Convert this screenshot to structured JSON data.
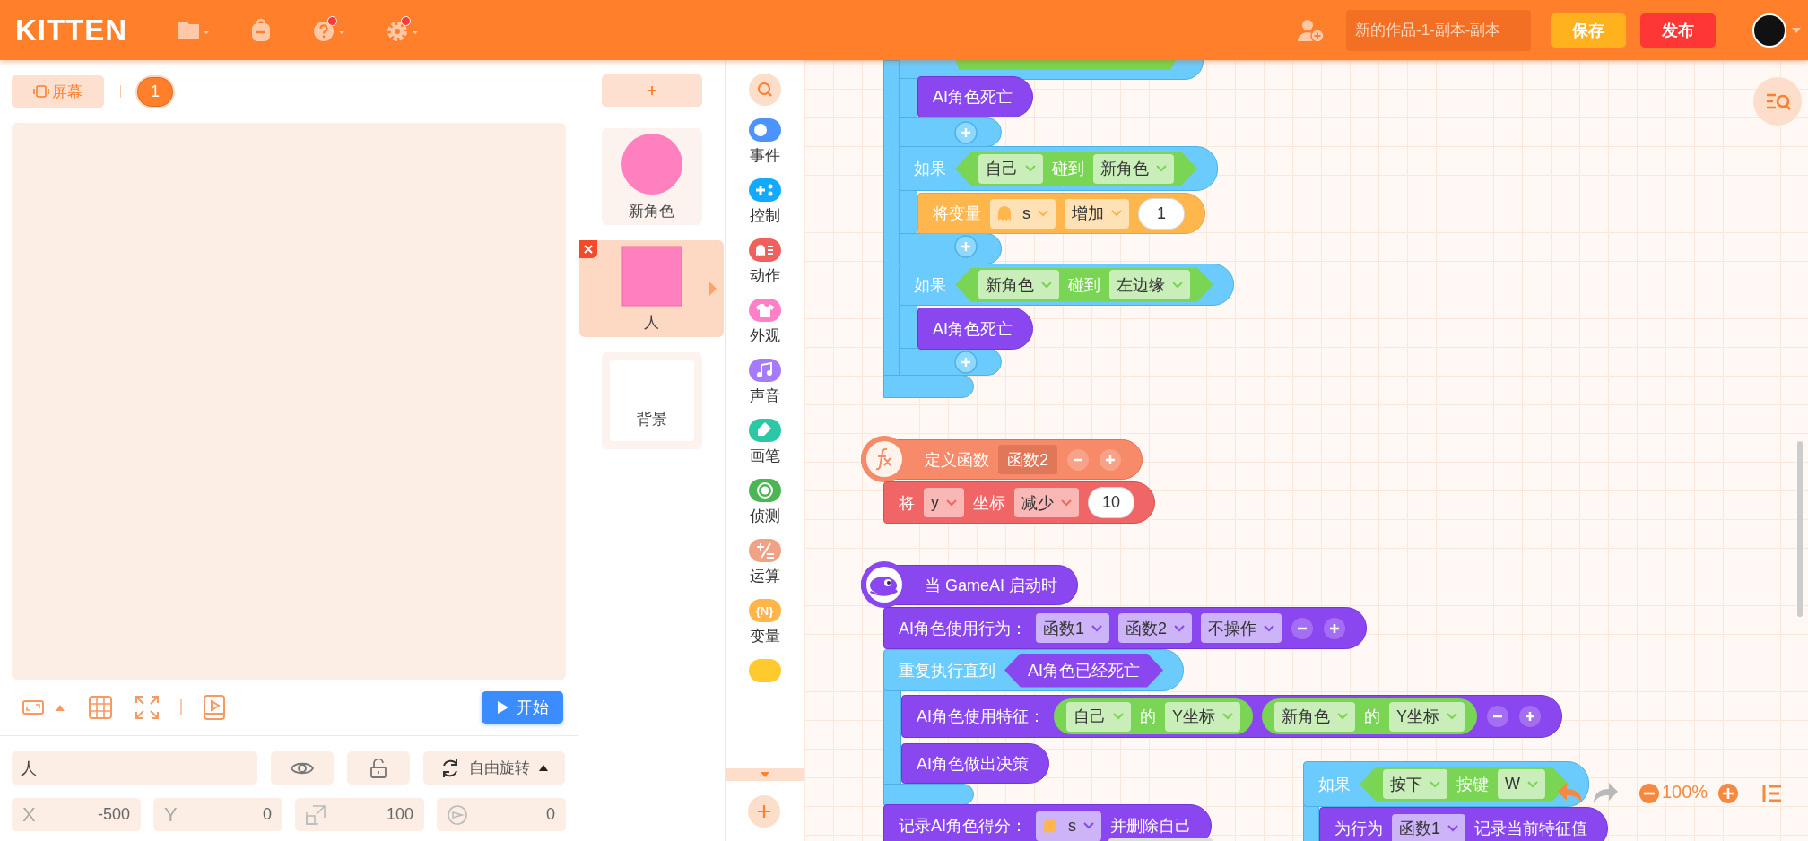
{
  "header": {
    "logo": "KITTEN",
    "toolbar_icons": [
      {
        "kind": "folder",
        "dot": false
      },
      {
        "kind": "bag",
        "dot": false
      },
      {
        "kind": "help",
        "dot": true
      },
      {
        "kind": "settings",
        "dot": true
      }
    ],
    "project_name": "新的作品-1-副本-副本",
    "save_button": "保存",
    "publish_button": "发布"
  },
  "stage_tabs": [
    {
      "label": "屏幕",
      "selected": false
    },
    {
      "label": "1",
      "selected": true
    }
  ],
  "start_button": "开始",
  "sprite_props": {
    "name": "人",
    "rotation": "自由旋转",
    "fields": [
      {
        "kind": "x",
        "label": "X",
        "value": "-500"
      },
      {
        "kind": "y",
        "label": "Y",
        "value": "0"
      },
      {
        "kind": "size",
        "value": "100"
      },
      {
        "kind": "direction",
        "value": "0"
      }
    ]
  },
  "sprites": [
    {
      "name": "新角色",
      "kind": "circle",
      "selected": false
    },
    {
      "name": "人",
      "kind": "square",
      "selected": true
    },
    {
      "name": "背景",
      "kind": "background",
      "selected": false
    }
  ],
  "categories": [
    {
      "kind": "events",
      "label": "事件",
      "color": "#4c93ff"
    },
    {
      "kind": "control",
      "label": "控制",
      "color": "#12aaff"
    },
    {
      "kind": "motion",
      "label": "动作",
      "color": "#f0605c"
    },
    {
      "kind": "looks",
      "label": "外观",
      "color": "#ff80c8"
    },
    {
      "kind": "sound",
      "label": "声音",
      "color": "#a67bfa"
    },
    {
      "kind": "pen",
      "label": "画笔",
      "color": "#2bc8a6"
    },
    {
      "kind": "sensing",
      "label": "侦测",
      "color": "#4cb654"
    },
    {
      "kind": "operators",
      "label": "运算",
      "color": "#f0a284"
    },
    {
      "kind": "variables",
      "label": "变量",
      "color": "#ffb54a",
      "icon_text": "{N}"
    },
    {
      "kind": "list",
      "color": "#ffca2e"
    }
  ],
  "script_blocks": [
    {
      "kind": "ai",
      "parts": [
        {
          "kind": "label",
          "text": "AI角色死亡"
        }
      ]
    },
    {
      "kind": "control",
      "parts": [
        {
          "kind": "label",
          "text": "如果"
        },
        {
          "kind": "condition",
          "color": "#79d553",
          "parts": [
            {
              "kind": "dropdown",
              "text": "自己"
            },
            {
              "kind": "label",
              "text": "碰到"
            },
            {
              "kind": "dropdown",
              "text": "新角色"
            }
          ]
        }
      ]
    },
    {
      "kind": "variable",
      "parts": [
        {
          "kind": "label",
          "text": "将变量"
        },
        {
          "kind": "var-dropdown",
          "text": "s"
        },
        {
          "kind": "dropdown",
          "text": "增加"
        },
        {
          "kind": "number",
          "text": "1"
        }
      ]
    },
    {
      "kind": "control",
      "parts": [
        {
          "kind": "label",
          "text": "如果"
        },
        {
          "kind": "condition",
          "color": "#79d553",
          "parts": [
            {
              "kind": "dropdown",
              "text": "新角色"
            },
            {
              "kind": "label",
              "text": "碰到"
            },
            {
              "kind": "dropdown",
              "text": "左边缘"
            }
          ]
        }
      ]
    },
    {
      "kind": "ai",
      "parts": [
        {
          "kind": "label",
          "text": "AI角色死亡"
        }
      ]
    },
    {
      "kind": "function",
      "parts": [
        {
          "kind": "label",
          "text": "定义函数"
        },
        {
          "kind": "slot",
          "text": "函数2"
        },
        {
          "kind": "minus"
        },
        {
          "kind": "plus"
        }
      ]
    },
    {
      "kind": "motion",
      "parts": [
        {
          "kind": "label",
          "text": "将"
        },
        {
          "kind": "dropdown",
          "text": "y"
        },
        {
          "kind": "label",
          "text": "坐标"
        },
        {
          "kind": "dropdown",
          "text": "减少"
        },
        {
          "kind": "number",
          "text": "10"
        }
      ]
    },
    {
      "kind": "event",
      "parts": [
        {
          "kind": "label",
          "text": "当 GameAI 启动时"
        }
      ]
    },
    {
      "kind": "ai",
      "parts": [
        {
          "kind": "label",
          "text": "AI角色使用行为："
        },
        {
          "kind": "dropdown",
          "text": "函数1"
        },
        {
          "kind": "dropdown",
          "text": "函数2"
        },
        {
          "kind": "dropdown",
          "text": "不操作"
        },
        {
          "kind": "minus"
        },
        {
          "kind": "plus"
        }
      ]
    },
    {
      "kind": "control",
      "parts": [
        {
          "kind": "label",
          "text": "重复执行直到"
        },
        {
          "kind": "condition",
          "color": "#8a46ef",
          "parts": [
            {
              "kind": "label",
              "text": "AI角色已经死亡"
            }
          ]
        }
      ]
    },
    {
      "kind": "ai",
      "parts": [
        {
          "kind": "label",
          "text": "AI角色使用特征："
        },
        {
          "kind": "reporter",
          "color": "#79d553",
          "parts": [
            {
              "kind": "dropdown",
              "text": "自己"
            },
            {
              "kind": "label",
              "text": "的"
            },
            {
              "kind": "dropdown",
              "text": "Y坐标"
            }
          ]
        },
        {
          "kind": "reporter",
          "color": "#79d553",
          "parts": [
            {
              "kind": "dropdown",
              "text": "新角色"
            },
            {
              "kind": "label",
              "text": "的"
            },
            {
              "kind": "dropdown",
              "text": "Y坐标"
            }
          ]
        },
        {
          "kind": "minus"
        },
        {
          "kind": "plus"
        }
      ]
    },
    {
      "kind": "ai",
      "parts": [
        {
          "kind": "label",
          "text": "AI角色做出决策"
        }
      ]
    },
    {
      "kind": "ai",
      "parts": [
        {
          "kind": "label",
          "text": "记录AI角色得分："
        },
        {
          "kind": "var-dropdown",
          "text": "s"
        },
        {
          "kind": "label",
          "text": "并删除自己"
        }
      ]
    },
    {
      "kind": "control",
      "parts": [
        {
          "kind": "label",
          "text": "如果"
        },
        {
          "kind": "condition",
          "color": "#79d553",
          "parts": [
            {
              "kind": "dropdown",
              "text": "按下"
            },
            {
              "kind": "label",
              "text": "按键"
            },
            {
              "kind": "dropdown",
              "text": "W"
            }
          ]
        }
      ]
    },
    {
      "kind": "ai",
      "parts": [
        {
          "kind": "label",
          "text": "为行为"
        },
        {
          "kind": "dropdown",
          "text": "函数1"
        },
        {
          "kind": "label",
          "text": "记录当前特征值"
        }
      ]
    }
  ],
  "zoom": "100%"
}
